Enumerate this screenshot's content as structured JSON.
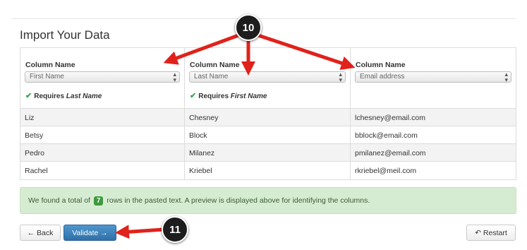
{
  "page": {
    "title": "Import Your Data"
  },
  "columns": [
    {
      "header": "Column Name",
      "selected": "First Name",
      "requires_prefix": "Requires",
      "requires_field": "Last Name"
    },
    {
      "header": "Column Name",
      "selected": "Last Name",
      "requires_prefix": "Requires",
      "requires_field": "First Name"
    },
    {
      "header": "Column Name",
      "selected": "Email address",
      "requires_prefix": "",
      "requires_field": ""
    }
  ],
  "rows": [
    [
      "Liz",
      "Chesney",
      "lchesney@email.com"
    ],
    [
      "Betsy",
      "Block",
      "bblock@email.com"
    ],
    [
      "Pedro",
      "Milanez",
      "pmilanez@email.com"
    ],
    [
      "Rachel",
      "Kriebel",
      "rkriebel@meil.com"
    ]
  ],
  "notice": {
    "before": "We found a total of",
    "count": "7",
    "after": "rows in the pasted text. A preview is displayed above for identifying the columns."
  },
  "buttons": {
    "back": "← Back",
    "validate": "Validate →",
    "restart": "↶ Restart"
  },
  "callouts": {
    "first": "10",
    "second": "11"
  },
  "colors": {
    "arrow": "#e0221b",
    "validate": "#337ab7",
    "notice_bg": "#d6ecd2",
    "check": "#3aa54a"
  },
  "icons": {
    "check": "check-icon",
    "select_arrows": "select-arrows-icon"
  }
}
